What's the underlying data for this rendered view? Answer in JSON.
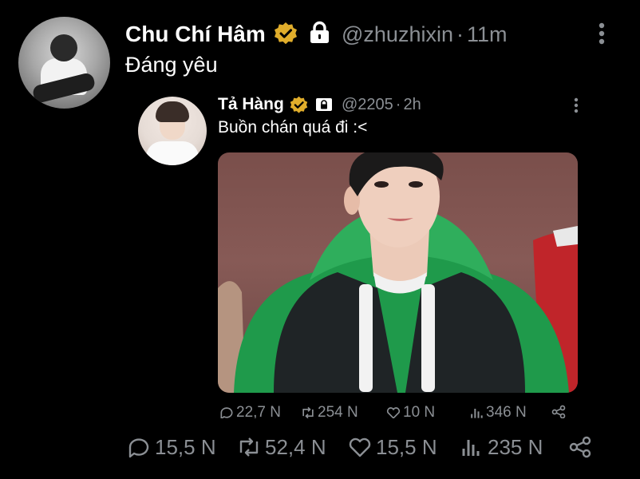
{
  "tweet": {
    "display_name": "Chu Chí Hâm",
    "handle": "@zhuzhixin",
    "time": "11m",
    "separator": "·",
    "text": "Đáng yêu",
    "verified_color": "#e0ad2b",
    "actions": {
      "replies": "15,5 N",
      "retweets": "52,4 N",
      "likes": "15,5 N",
      "views": "235 N"
    }
  },
  "quoted_tweet": {
    "display_name": "Tả Hàng",
    "handle": "@2205",
    "time": "2h",
    "separator": "·",
    "text": "Buồn chán quá đi :<",
    "actions": {
      "replies": "22,7 N",
      "retweets": "254 N",
      "likes": "10 N",
      "views": "346 N"
    }
  },
  "icons": {
    "verified": "verified-badge-icon",
    "lock": "lock-icon",
    "more": "more-vertical-icon",
    "reply": "reply-icon",
    "retweet": "retweet-icon",
    "like": "heart-icon",
    "views": "views-icon",
    "share": "share-icon"
  },
  "colors": {
    "background": "#000000",
    "text": "#ffffff",
    "muted": "#8b8f94",
    "badge_gold": "#e0ad2b"
  }
}
